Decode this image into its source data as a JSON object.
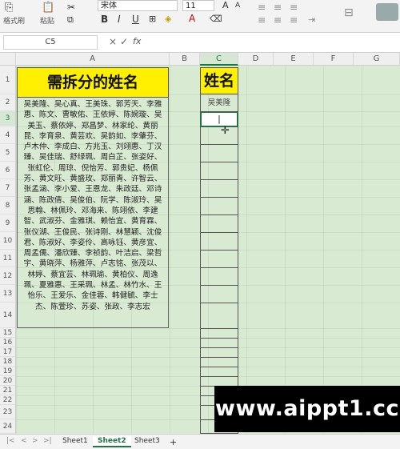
{
  "ribbon": {
    "format_painter": "格式刷",
    "paste": "粘贴",
    "font_name": "宋体",
    "font_size": "11",
    "bold": "B",
    "italic": "I",
    "underline": "U",
    "font_color_glyph": "A",
    "grow_font": "A",
    "shrink_font": "A"
  },
  "formula_bar": {
    "name_box": "C5",
    "cancel": "×",
    "confirm": "✓",
    "fx": "fx",
    "value": ""
  },
  "columns": [
    "A",
    "B",
    "C",
    "D",
    "E",
    "F",
    "G"
  ],
  "rows": [
    "1",
    "2",
    "3",
    "4",
    "5",
    "6",
    "7",
    "8",
    "9",
    "10",
    "11",
    "12",
    "13",
    "14",
    "15",
    "16",
    "17",
    "18",
    "19",
    "20",
    "21",
    "22",
    "23",
    "24"
  ],
  "sheet": {
    "a1_header": "需拆分的姓名",
    "a2_text": "吴美隆、吴心真、王美珠、郭芳天、李雅惠、陈文、曹敏佑、王依婷、陈婉璇、吴美玉、蔡依婷、郑昌梦、林家纶、黄丽昆、李育泉、黄芸欢、吴韵如、李肇芬、卢木仲、李成白、方兆玉、刘翊惠、丁汉臻、吴佳瑞、舒绿珮、周白芷、张姿好、张虹伦、周琼、倪怡芳、郭贵妃、杨佩芳、黄文旺、黄盛玫、郑丽青、许智云、张孟涵、李小爱、王恩龙、朱政廷、邓诗涵、陈政倩、吴俊伯、阮学、陈淑玲、吴思翰、林佩玲、邓海来、陈翊依、李建智、武淑芬、金雅琪、赖怡宜、黄育霖、张仪湖、王俊民、张诗刚、林慧颖、沈俊君、陈淑好、李姿伶、高咏钰、黄彦宜、周孟儒、潘欣臻、李祯韵、叶洁启、梁哲宇、黄晓萍、杨雅萍、卢志铭、张茂以、林婷、蔡宜芸、林珮瑜、黄柏仪、周逸珮、夏雅惠、王采珮、林孟、林竹水、王怡乐、王爱乐、金佳蓉、韩健毓、李士杰、陈萱珍、苏姿、张政、李志宏",
    "c1_header": "姓名",
    "c2_value": "吴美隆",
    "c3_value": "|"
  },
  "tabs": [
    "Sheet1",
    "Sheet2",
    "Sheet3",
    "+"
  ],
  "tab_nav": [
    "|<",
    "<",
    ">",
    ">|"
  ],
  "watermark": "www.aippt1.cc",
  "colors": {
    "header_fill": "#ffef00",
    "sheet_bg": "#d9ead3",
    "accent": "#217346"
  }
}
